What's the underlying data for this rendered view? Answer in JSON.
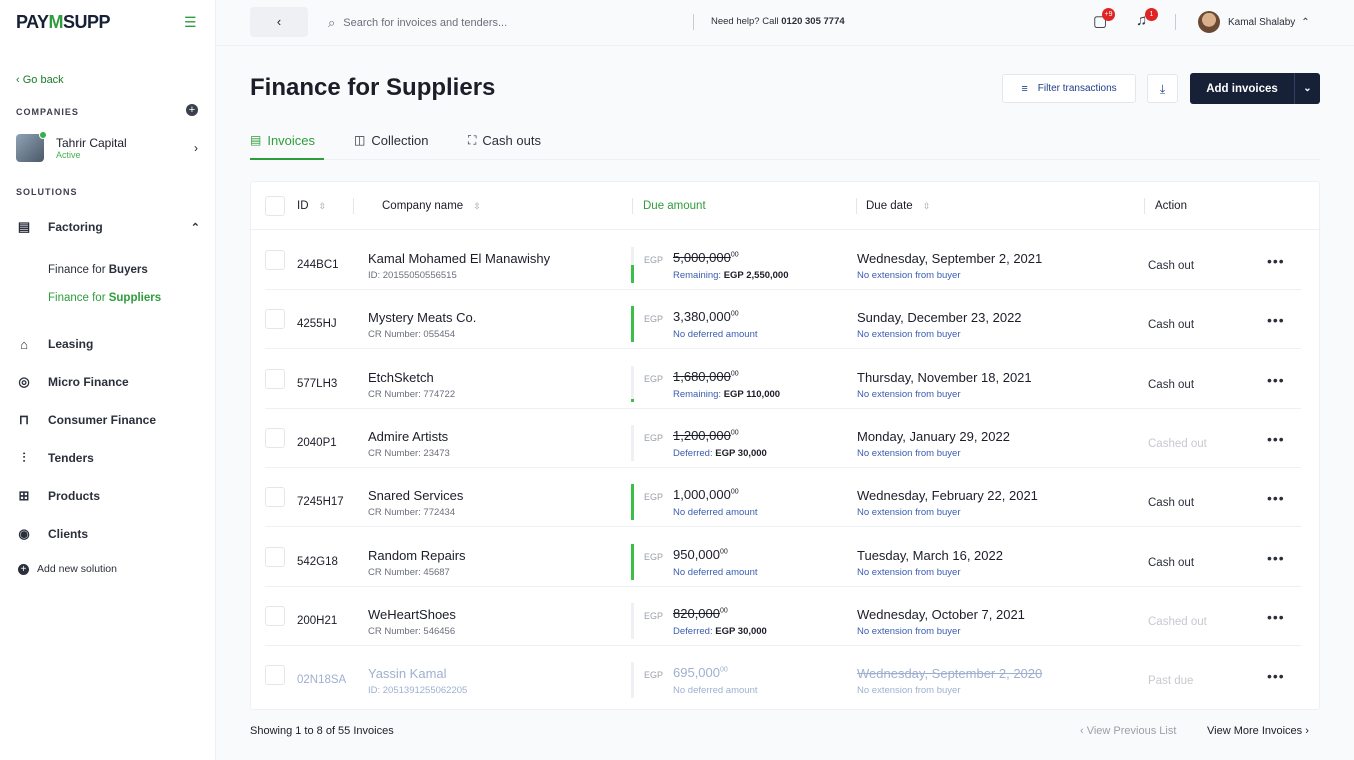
{
  "sidebar": {
    "logo_a": "PAY",
    "logo_b": "M",
    "logo_c": "SUPP",
    "go_back": "‹  Go back",
    "companies_label": "COMPANIES",
    "company": {
      "name": "Tahrir Capital",
      "status": "Active"
    },
    "solutions_label": "SOLUTIONS",
    "factoring": "Factoring",
    "sub_buyers_pre": "Finance for ",
    "sub_buyers_bold": "Buyers",
    "sub_suppliers_pre": "Finance for ",
    "sub_suppliers_bold": "Suppliers",
    "items": [
      {
        "label": "Leasing",
        "icon": "home-icon"
      },
      {
        "label": "Micro Finance",
        "icon": "coins-icon"
      },
      {
        "label": "Consumer Finance",
        "icon": "bag-icon"
      },
      {
        "label": "Tenders",
        "icon": "chart-icon"
      },
      {
        "label": "Products",
        "icon": "box-icon"
      },
      {
        "label": "Clients",
        "icon": "user-circle-icon"
      }
    ],
    "add_solution": "Add new solution"
  },
  "topbar": {
    "search_placeholder": "Search for invoices and tenders...",
    "help_text": "Need help?  Call ",
    "help_phone": "0120 305 7774",
    "chat_badge": "+9",
    "bell_badge": "1",
    "user_name": "Kamal Shalaby"
  },
  "page": {
    "title": "Finance for Suppliers",
    "filter_label": "Filter transactions",
    "add_label": "Add invoices",
    "tabs": [
      {
        "label": "Invoices",
        "icon": "document-icon"
      },
      {
        "label": "Collection",
        "icon": "collection-icon"
      },
      {
        "label": "Cash outs",
        "icon": "cashout-icon"
      }
    ]
  },
  "table": {
    "headers": {
      "id": "ID",
      "company": "Company name",
      "due_amount": "Due amount",
      "due_date": "Due date",
      "action": "Action"
    },
    "rows": [
      {
        "id": "244BC1",
        "company": "Kamal Mohamed El Manawishy",
        "company_sub": "ID: 20155050556515",
        "currency": "EGP",
        "amount": "5,000,000",
        "cents": "00",
        "strike": true,
        "amount_sub": "Remaining: ",
        "amount_sub_bold": "EGP 2,550,000",
        "paid_fraction": 0.49,
        "date": "Wednesday, September 2, 2021",
        "date_sub": "No extension from buyer",
        "action": "Cash out",
        "action_muted": false,
        "past": false
      },
      {
        "id": "4255HJ",
        "company": "Mystery Meats Co.",
        "company_sub": "CR Number: 055454",
        "currency": "EGP",
        "amount": "3,380,000",
        "cents": "00",
        "strike": false,
        "amount_sub": "No deferred amount",
        "amount_sub_bold": "",
        "paid_fraction": 1.0,
        "date": "Sunday, December 23, 2022",
        "date_sub": "No extension from buyer",
        "action": "Cash out",
        "action_muted": false,
        "past": false
      },
      {
        "id": "577LH3",
        "company": "EtchSketch",
        "company_sub": "CR Number: 774722",
        "currency": "EGP",
        "amount": "1,680,000",
        "cents": "00",
        "strike": true,
        "amount_sub": "Remaining: ",
        "amount_sub_bold": "EGP 110,000",
        "paid_fraction": 0.07,
        "date": "Thursday, November 18, 2021",
        "date_sub": "No extension from buyer",
        "action": "Cash out",
        "action_muted": false,
        "past": false
      },
      {
        "id": "2040P1",
        "company": "Admire Artists",
        "company_sub": "CR Number: 23473",
        "currency": "EGP",
        "amount": "1,200,000",
        "cents": "00",
        "strike": true,
        "amount_sub": "Deferred: ",
        "amount_sub_bold": "EGP 30,000",
        "paid_fraction": 0,
        "date": "Monday, January 29, 2022",
        "date_sub": "No extension from buyer",
        "action": "Cashed out",
        "action_muted": true,
        "past": false
      },
      {
        "id": "7245H17",
        "company": "Snared Services",
        "company_sub": "CR Number: 772434",
        "currency": "EGP",
        "amount": "1,000,000",
        "cents": "00",
        "strike": false,
        "amount_sub": "No deferred amount",
        "amount_sub_bold": "",
        "paid_fraction": 1.0,
        "date": "Wednesday, February 22, 2021",
        "date_sub": "No extension from buyer",
        "action": "Cash out",
        "action_muted": false,
        "past": false
      },
      {
        "id": "542G18",
        "company": "Random Repairs",
        "company_sub": "CR Number: 45687",
        "currency": "EGP",
        "amount": "950,000",
        "cents": "00",
        "strike": false,
        "amount_sub": "No deferred amount",
        "amount_sub_bold": "",
        "paid_fraction": 1.0,
        "date": "Tuesday, March 16, 2022",
        "date_sub": "No extension from buyer",
        "action": "Cash out",
        "action_muted": false,
        "past": false
      },
      {
        "id": "200H21",
        "company": "WeHeartShoes",
        "company_sub": "CR Number: 546456",
        "currency": "EGP",
        "amount": "820,000",
        "cents": "00",
        "strike": true,
        "amount_sub": "Deferred: ",
        "amount_sub_bold": "EGP 30,000",
        "paid_fraction": 0,
        "date": "Wednesday, October 7, 2021",
        "date_sub": "No extension from buyer",
        "action": "Cashed out",
        "action_muted": true,
        "past": false
      },
      {
        "id": "02N18SA",
        "company": "Yassin Kamal",
        "company_sub": "ID: 2051391255062205",
        "currency": "EGP",
        "amount": "695,000",
        "cents": "00",
        "strike": false,
        "amount_sub": "No deferred amount",
        "amount_sub_bold": "",
        "paid_fraction": 0,
        "date": "Wednesday, September 2, 2020",
        "date_sub": "No extension from buyer",
        "action": "Past due",
        "action_muted": true,
        "past": true
      }
    ]
  },
  "footer": {
    "showing": "Showing 1 to 8 of 55 Invoices",
    "prev": "‹  View Previous List",
    "next": "View More Invoices  ›"
  }
}
